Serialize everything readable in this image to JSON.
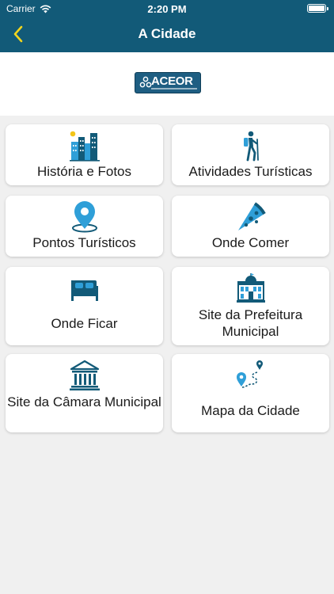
{
  "status_bar": {
    "carrier": "Carrier",
    "time": "2:20 PM"
  },
  "nav": {
    "title": "A Cidade",
    "back_icon": "chevron-left-icon"
  },
  "logo": {
    "text": "ACEOR"
  },
  "colors": {
    "header": "#125a78",
    "icon_blue": "#125a78",
    "icon_accent": "#2f9fd8",
    "back_arrow": "#f2d51c"
  },
  "menu": [
    {
      "label": "História e Fotos",
      "icon": "city-buildings-icon"
    },
    {
      "label": "Atividades Turísticas",
      "icon": "hiker-icon"
    },
    {
      "label": "Pontos Turísticos",
      "icon": "location-pin-icon"
    },
    {
      "label": "Onde Comer",
      "icon": "pizza-slice-icon"
    },
    {
      "label": "Onde Ficar",
      "icon": "bed-icon"
    },
    {
      "label": "Site da Prefeitura Municipal",
      "icon": "city-hall-icon"
    },
    {
      "label": "Site da Câmara Municipal",
      "icon": "government-building-icon"
    },
    {
      "label": "Mapa da Cidade",
      "icon": "route-map-icon"
    }
  ]
}
